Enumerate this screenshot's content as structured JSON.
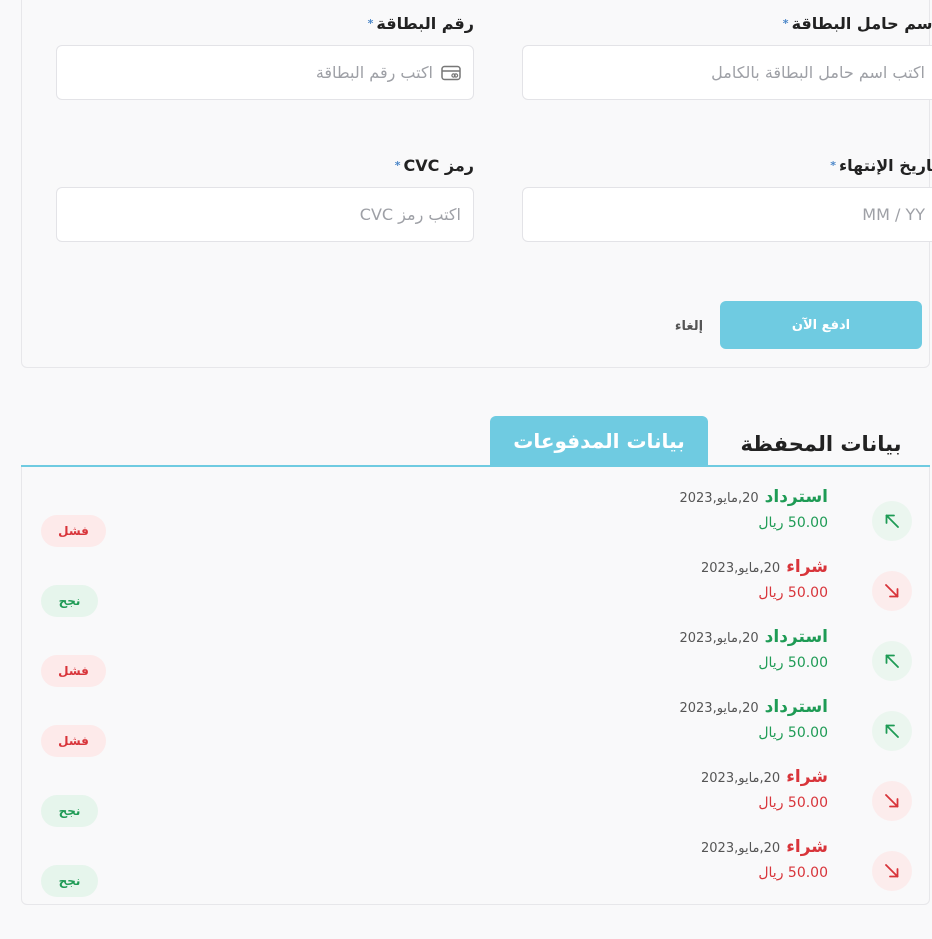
{
  "form": {
    "holder_label": "اسم حامل البطاقة",
    "holder_placeholder": "اكتب اسم حامل البطاقة بالكامل",
    "number_label": "رقم البطاقة",
    "number_placeholder": "اكتب رقم البطاقة",
    "expiry_label": "تاريخ الإنتهاء",
    "expiry_placeholder": "MM / YY",
    "cvc_label": "رمز CVC",
    "cvc_placeholder": "اكتب رمز CVC",
    "required_mark": "*",
    "pay_label": "ادفع الآن",
    "cancel_label": "إلغاء"
  },
  "tabs": {
    "wallet": "بيانات المحفظة",
    "payments": "بيانات المدفوعات"
  },
  "transactions": [
    {
      "type": "استرداد",
      "kind": "refund",
      "date": "20,مايو,2023",
      "amount": "50.00 ريال",
      "status": "فشل",
      "status_kind": "fail"
    },
    {
      "type": "شراء",
      "kind": "purchase",
      "date": "20,مايو,2023",
      "amount": "50.00 ريال",
      "status": "نجح",
      "status_kind": "ok"
    },
    {
      "type": "استرداد",
      "kind": "refund",
      "date": "20,مايو,2023",
      "amount": "50.00 ريال",
      "status": "فشل",
      "status_kind": "fail"
    },
    {
      "type": "استرداد",
      "kind": "refund",
      "date": "20,مايو,2023",
      "amount": "50.00 ريال",
      "status": "فشل",
      "status_kind": "fail"
    },
    {
      "type": "شراء",
      "kind": "purchase",
      "date": "20,مايو,2023",
      "amount": "50.00 ريال",
      "status": "نجح",
      "status_kind": "ok"
    },
    {
      "type": "شراء",
      "kind": "purchase",
      "date": "20,مايو,2023",
      "amount": "50.00 ريال",
      "status": "نجح",
      "status_kind": "ok"
    }
  ],
  "colors": {
    "accent": "#6fcbe1",
    "refund": "#1e9b55",
    "purchase": "#d8343a"
  },
  "icons": {
    "refund": "arrow-up-left-icon",
    "purchase": "arrow-down-right-icon",
    "card": "credit-card-icon"
  }
}
